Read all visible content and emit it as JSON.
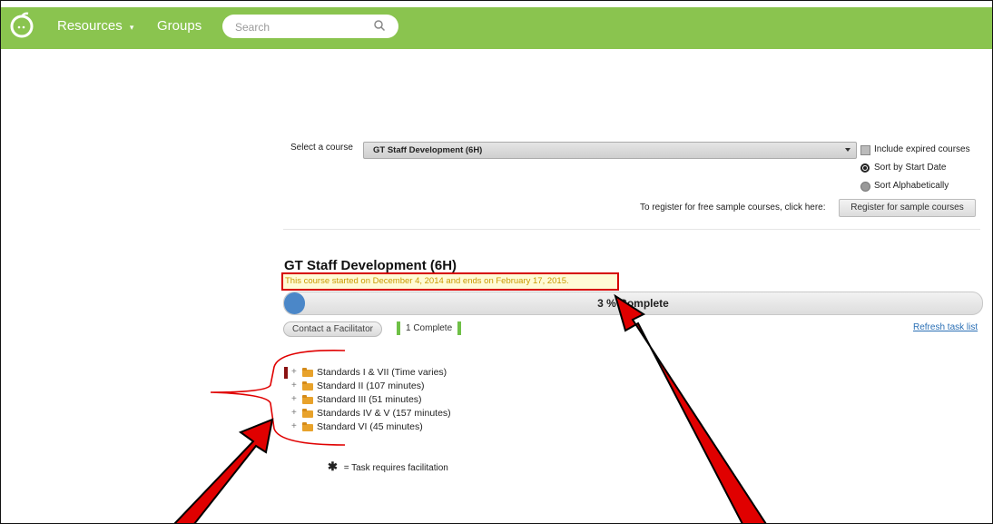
{
  "nav": {
    "resources_label": "Resources",
    "groups_label": "Groups",
    "search_placeholder": "Search",
    "brand_color": "#8ac44f"
  },
  "course_select": {
    "label": "Select a course",
    "selected": "GT Staff Development (6H)"
  },
  "options": {
    "include_expired": "Include expired courses",
    "sort_start": "Sort by Start Date",
    "sort_alpha": "Sort Alphabetically"
  },
  "register": {
    "text": "To register for free sample courses, click here:",
    "button": "Register for sample courses"
  },
  "course": {
    "title": "GT Staff Development (6H)",
    "dates": "This course started on December 4, 2014 and ends on February 17, 2015.",
    "progress_text": "3 % Complete",
    "progress_percent": 3
  },
  "actions": {
    "contact": "Contact a Facilitator",
    "complete_badge": "1 Complete",
    "refresh": "Refresh task list"
  },
  "standards": [
    {
      "label": "Standards  I & VII (Time varies)"
    },
    {
      "label": "Standard II (107 minutes)"
    },
    {
      "label": "Standard III (51 minutes)"
    },
    {
      "label": "Standards IV & V (157 minutes)"
    },
    {
      "label": "Standard VI (45 minutes)"
    }
  ],
  "legend": {
    "symbol": "✱",
    "text": "= Task requires facilitation"
  },
  "annotation_color": "#e00000"
}
